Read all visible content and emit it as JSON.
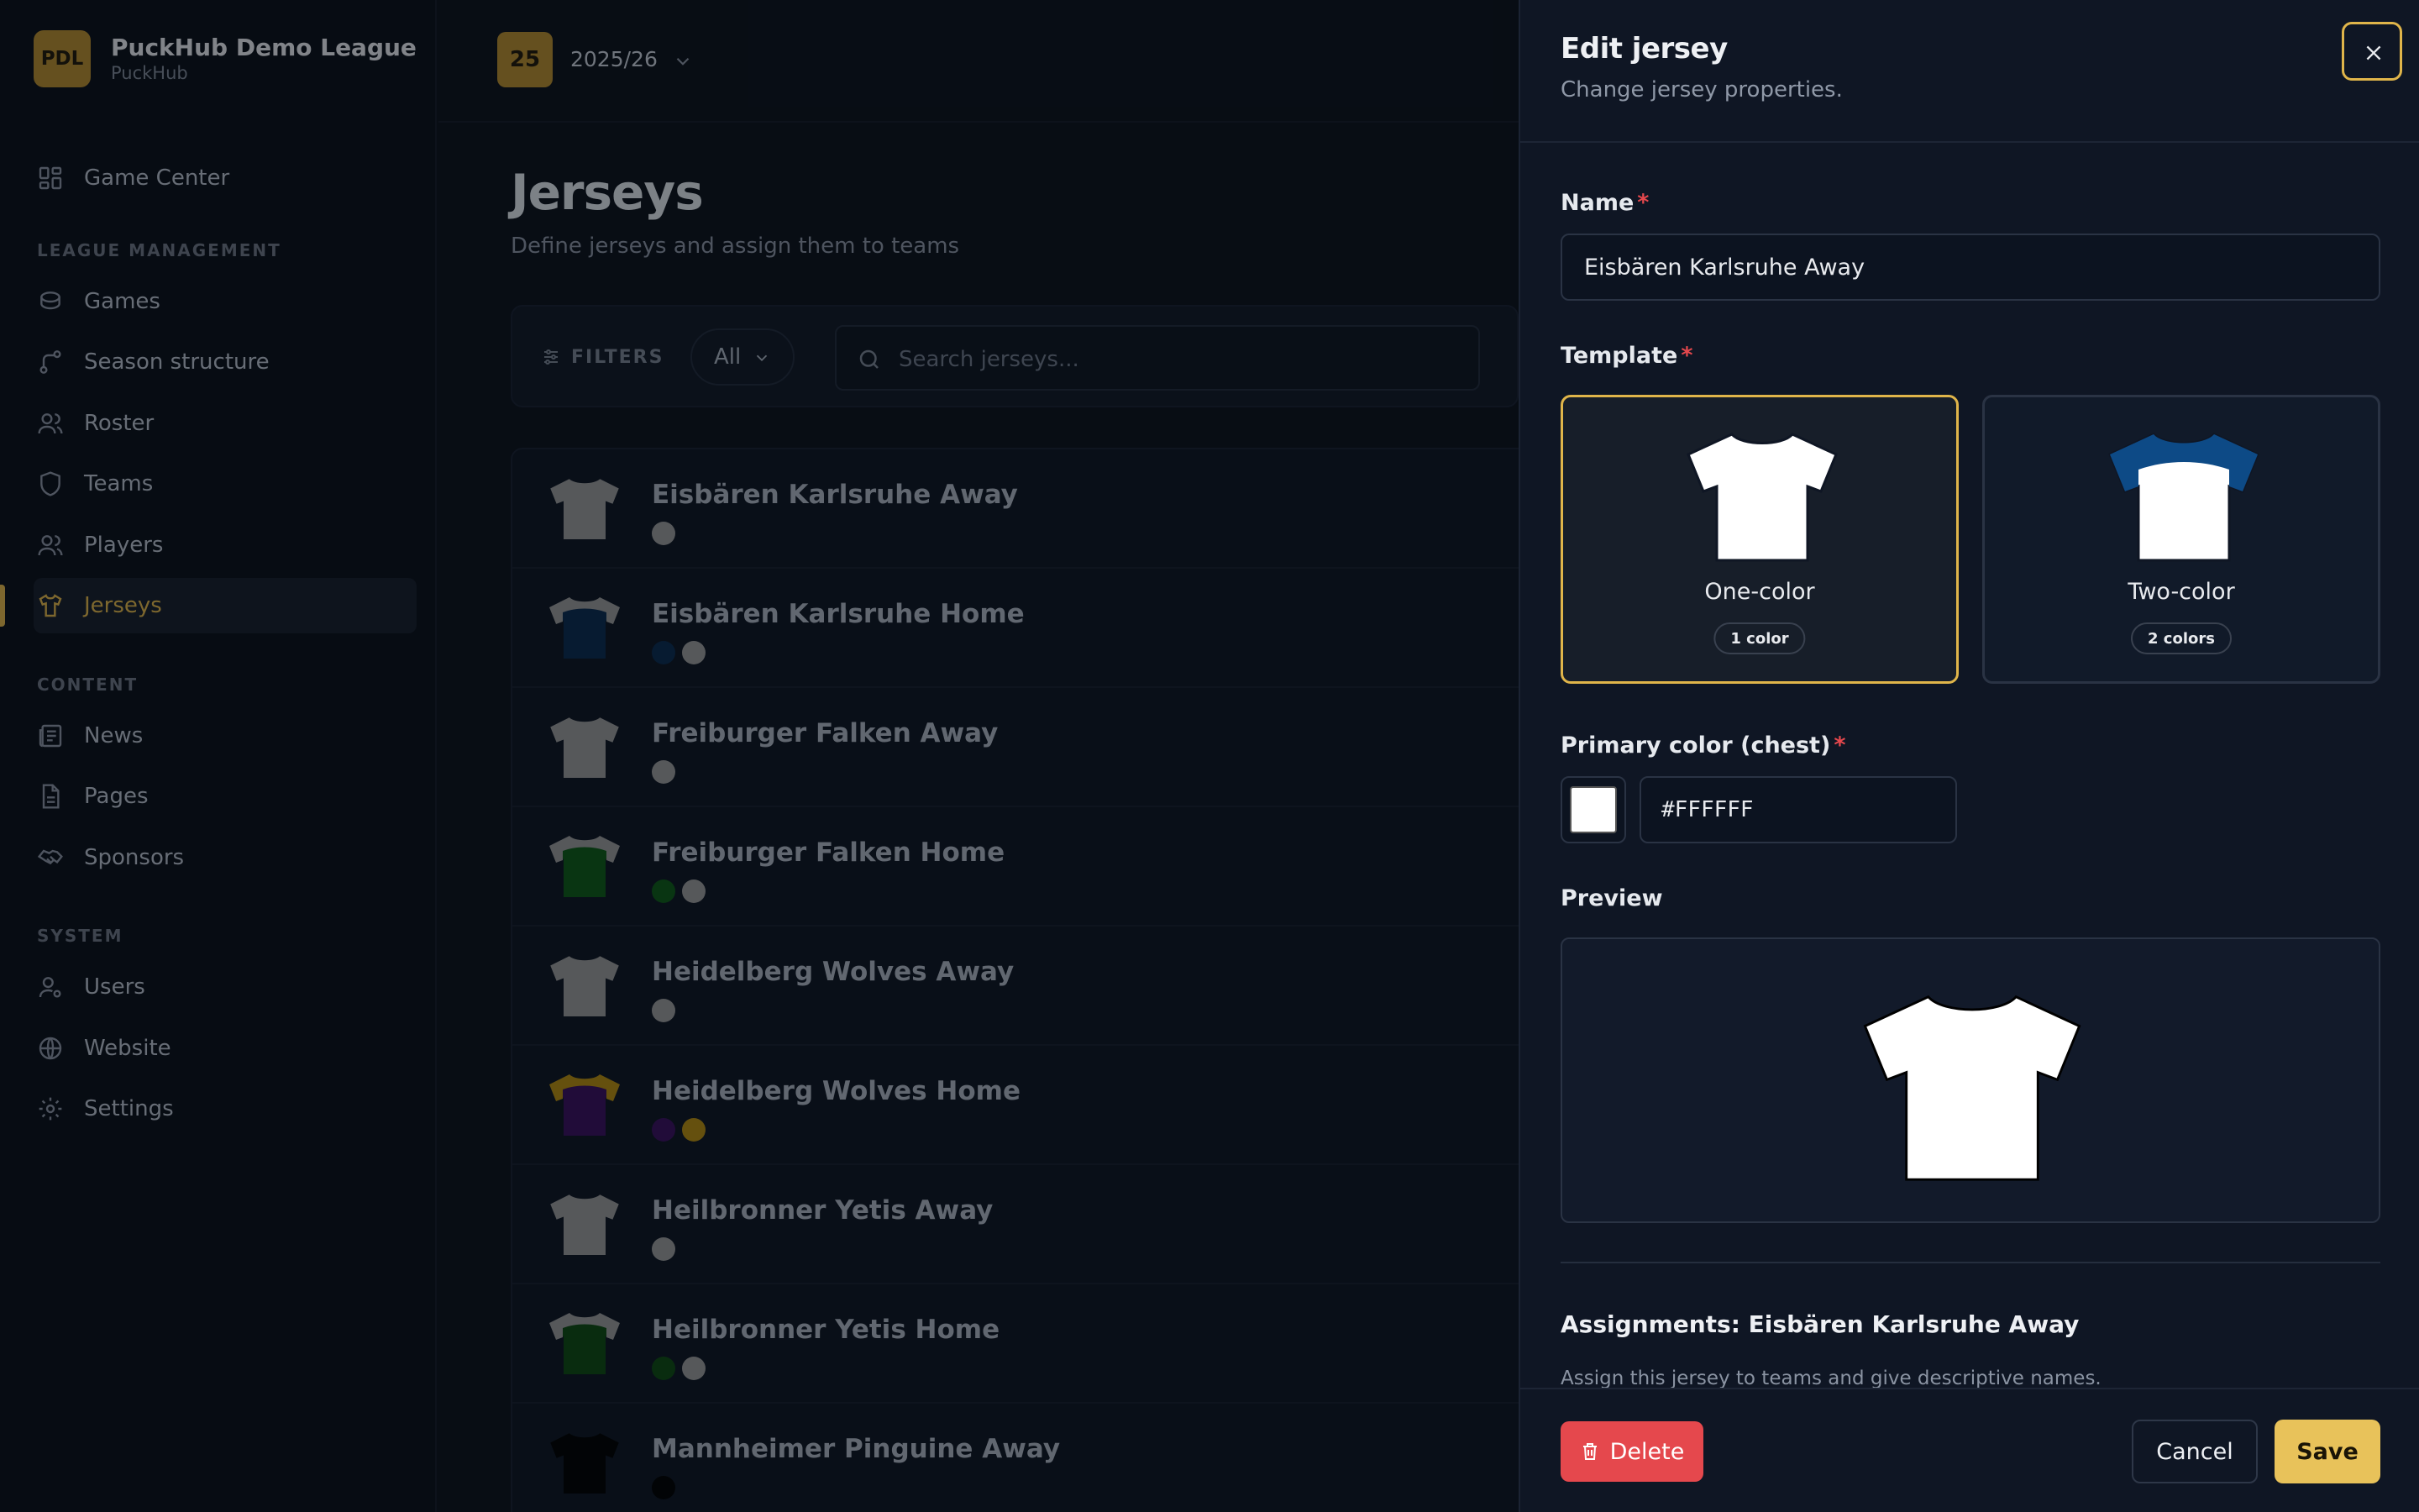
{
  "brand": {
    "logo_text": "PDL",
    "name": "PuckHub Demo League",
    "sub": "PuckHub"
  },
  "season": {
    "badge": "25",
    "label": "2025/26"
  },
  "sidebar": {
    "game_center": "Game Center",
    "sections": {
      "league": "LEAGUE MANAGEMENT",
      "content": "CONTENT",
      "system": "SYSTEM"
    },
    "items": [
      {
        "label": "Games",
        "icon": "database-icon"
      },
      {
        "label": "Season structure",
        "icon": "branch-icon"
      },
      {
        "label": "Roster",
        "icon": "users-icon"
      },
      {
        "label": "Teams",
        "icon": "shield-icon"
      },
      {
        "label": "Players",
        "icon": "users-icon"
      },
      {
        "label": "Jerseys",
        "icon": "shirt-icon",
        "active": true
      },
      {
        "label": "News",
        "icon": "newspaper-icon"
      },
      {
        "label": "Pages",
        "icon": "file-icon"
      },
      {
        "label": "Sponsors",
        "icon": "handshake-icon"
      },
      {
        "label": "Users",
        "icon": "user-cog-icon"
      },
      {
        "label": "Website",
        "icon": "globe-icon"
      },
      {
        "label": "Settings",
        "icon": "gear-icon"
      }
    ]
  },
  "main": {
    "title": "Jerseys",
    "subtitle": "Define jerseys and assign them to teams",
    "filters_label": "FILTERS",
    "filter_value": "All",
    "search_placeholder": "Search jerseys...",
    "rows": [
      {
        "name": "Eisbären Karlsruhe Away",
        "colors": [
          "#9a9a9a"
        ]
      },
      {
        "name": "Eisbären Karlsruhe Home",
        "colors": [
          "#0a2a4f",
          "#9a9a9a"
        ]
      },
      {
        "name": "Freiburger Falken Away",
        "colors": [
          "#9a9a9a"
        ]
      },
      {
        "name": "Freiburger Falken Home",
        "colors": [
          "#0d5a17",
          "#9a9a9a"
        ]
      },
      {
        "name": "Heidelberg Wolves Away",
        "colors": [
          "#9a9a9a"
        ]
      },
      {
        "name": "Heidelberg Wolves Home",
        "colors": [
          "#3a0f5e",
          "#b48a10"
        ]
      },
      {
        "name": "Heilbronner Yetis Away",
        "colors": [
          "#9a9a9a"
        ]
      },
      {
        "name": "Heilbronner Yetis Home",
        "colors": [
          "#0d4a12",
          "#9a9a9a"
        ]
      },
      {
        "name": "Mannheimer Pinguine Away",
        "colors": [
          "#000000"
        ]
      }
    ]
  },
  "drawer": {
    "title": "Edit jersey",
    "subtitle": "Change jersey properties.",
    "name_label": "Name",
    "name_value": "Eisbären Karlsruhe Away",
    "required_mark": "*",
    "template_label": "Template",
    "templates": [
      {
        "name": "One-color",
        "badge": "1 color",
        "selected": true
      },
      {
        "name": "Two-color",
        "badge": "2 colors",
        "selected": false
      }
    ],
    "primary_label": "Primary color (chest)",
    "primary_value": "#FFFFFF",
    "preview_label": "Preview",
    "assign_title": "Assignments: Eisbären Karlsruhe Away",
    "assign_sub": "Assign this jersey to teams and give descriptive names.",
    "delete_label": "Delete",
    "cancel_label": "Cancel",
    "save_label": "Save"
  },
  "colors": {
    "accent": "#e0b54a",
    "danger": "#e5484d",
    "save": "#e8c25a",
    "two_color_yoke": "#0d4a86"
  }
}
